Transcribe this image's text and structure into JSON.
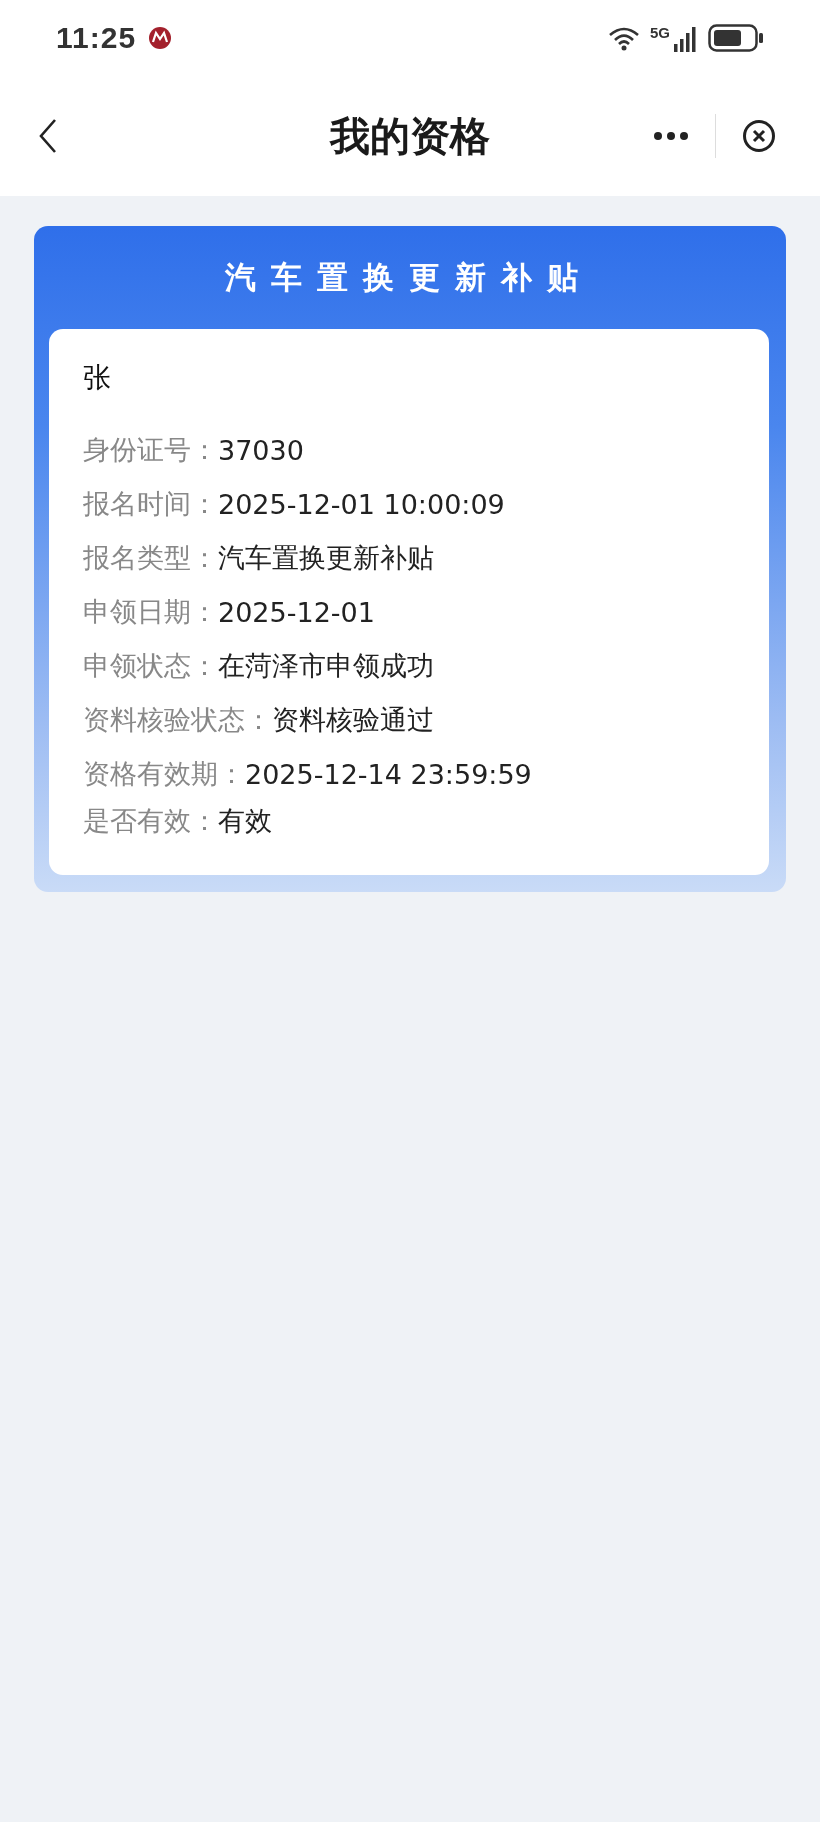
{
  "status_bar": {
    "time": "11:25",
    "network": "5G"
  },
  "header": {
    "title": "我的资格"
  },
  "card": {
    "title": "汽车置换更新补贴",
    "name": "张",
    "fields": [
      {
        "label": "身份证号：",
        "value": "37030"
      },
      {
        "label": "报名时间：",
        "value": "2025-12-01 10:00:09"
      },
      {
        "label": "报名类型：",
        "value": "汽车置换更新补贴"
      },
      {
        "label": "申领日期：",
        "value": "2025-12-01"
      },
      {
        "label": "申领状态：",
        "value": "在菏泽市申领成功"
      },
      {
        "label": "资料核验状态：",
        "value": "资料核验通过"
      },
      {
        "label": "资格有效期：",
        "value": "2025-12-14 23:59:59"
      },
      {
        "label": "是否有效：",
        "value": "有效"
      }
    ]
  }
}
